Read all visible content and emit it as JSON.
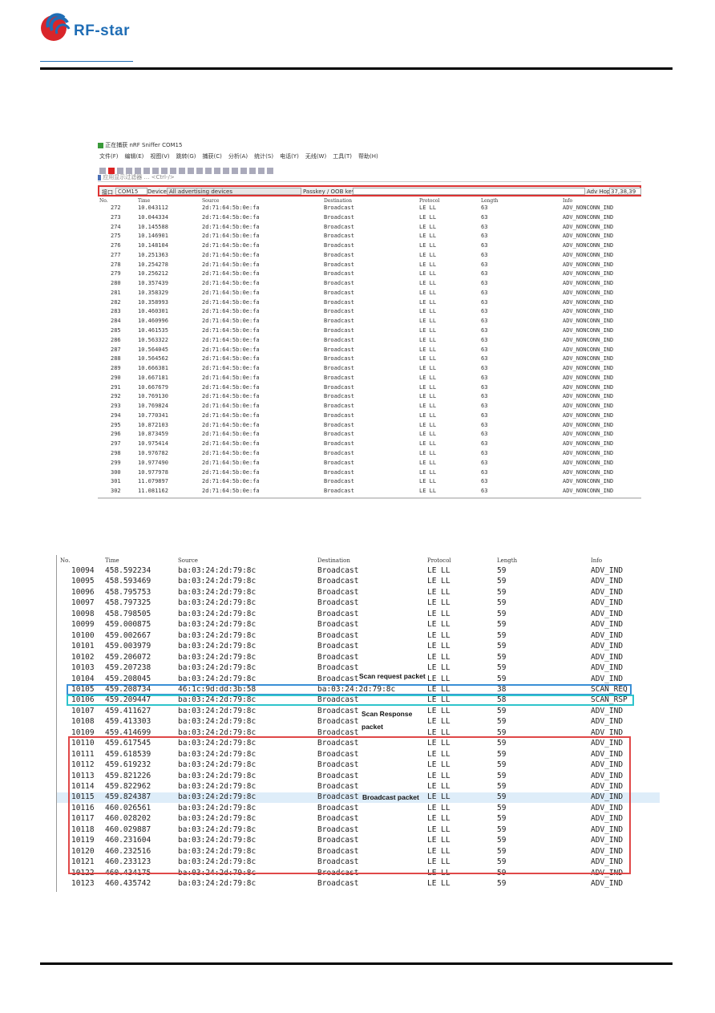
{
  "header": {
    "logo_text": "RF-star",
    "brand_color": "#1f6db5",
    "logo_icon": "rf-star-logo"
  },
  "screenshot1": {
    "title": "正在捕获 nRF Sniffer COM15",
    "menu": [
      "文件(F)",
      "编辑(E)",
      "视图(V)",
      "跳转(G)",
      "捕获(C)",
      "分析(A)",
      "统计(S)",
      "电话(Y)",
      "无线(W)",
      "工具(T)",
      "帮助(H)"
    ],
    "display_filter_placeholder": "应用显示过滤器 … <Ctrl-/>",
    "interface_label": "接口",
    "interface_value": "COM15",
    "device_label": "Device",
    "device_value": "All advertising devices",
    "passkey_label": "Passkey / OOB key",
    "passkey_value": "",
    "adv_hop_label": "Adv Hop",
    "adv_hop_value": "37,38,39",
    "columns": [
      "No.",
      "Time",
      "Source",
      "Destination",
      "Protocol",
      "Length",
      "Info"
    ],
    "rows": [
      [
        "272",
        "10.043112",
        "2d:71:64:5b:0e:fa",
        "Broadcast",
        "LE LL",
        "63",
        "ADV_NONCONN_IND"
      ],
      [
        "273",
        "10.044334",
        "2d:71:64:5b:0e:fa",
        "Broadcast",
        "LE LL",
        "63",
        "ADV_NONCONN_IND"
      ],
      [
        "274",
        "10.145588",
        "2d:71:64:5b:0e:fa",
        "Broadcast",
        "LE LL",
        "63",
        "ADV_NONCONN_IND"
      ],
      [
        "275",
        "10.146901",
        "2d:71:64:5b:0e:fa",
        "Broadcast",
        "LE LL",
        "63",
        "ADV_NONCONN_IND"
      ],
      [
        "276",
        "10.148104",
        "2d:71:64:5b:0e:fa",
        "Broadcast",
        "LE LL",
        "63",
        "ADV_NONCONN_IND"
      ],
      [
        "277",
        "10.251363",
        "2d:71:64:5b:0e:fa",
        "Broadcast",
        "LE LL",
        "63",
        "ADV_NONCONN_IND"
      ],
      [
        "278",
        "10.254278",
        "2d:71:64:5b:0e:fa",
        "Broadcast",
        "LE LL",
        "63",
        "ADV_NONCONN_IND"
      ],
      [
        "279",
        "10.256212",
        "2d:71:64:5b:0e:fa",
        "Broadcast",
        "LE LL",
        "63",
        "ADV_NONCONN_IND"
      ],
      [
        "280",
        "10.357439",
        "2d:71:64:5b:0e:fa",
        "Broadcast",
        "LE LL",
        "63",
        "ADV_NONCONN_IND"
      ],
      [
        "281",
        "10.358329",
        "2d:71:64:5b:0e:fa",
        "Broadcast",
        "LE LL",
        "63",
        "ADV_NONCONN_IND"
      ],
      [
        "282",
        "10.358993",
        "2d:71:64:5b:0e:fa",
        "Broadcast",
        "LE LL",
        "63",
        "ADV_NONCONN_IND"
      ],
      [
        "283",
        "10.460301",
        "2d:71:64:5b:0e:fa",
        "Broadcast",
        "LE LL",
        "63",
        "ADV_NONCONN_IND"
      ],
      [
        "284",
        "10.460996",
        "2d:71:64:5b:0e:fa",
        "Broadcast",
        "LE LL",
        "63",
        "ADV_NONCONN_IND"
      ],
      [
        "285",
        "10.461535",
        "2d:71:64:5b:0e:fa",
        "Broadcast",
        "LE LL",
        "63",
        "ADV_NONCONN_IND"
      ],
      [
        "286",
        "10.563322",
        "2d:71:64:5b:0e:fa",
        "Broadcast",
        "LE LL",
        "63",
        "ADV_NONCONN_IND"
      ],
      [
        "287",
        "10.564045",
        "2d:71:64:5b:0e:fa",
        "Broadcast",
        "LE LL",
        "63",
        "ADV_NONCONN_IND"
      ],
      [
        "288",
        "10.564562",
        "2d:71:64:5b:0e:fa",
        "Broadcast",
        "LE LL",
        "63",
        "ADV_NONCONN_IND"
      ],
      [
        "289",
        "10.666381",
        "2d:71:64:5b:0e:fa",
        "Broadcast",
        "LE LL",
        "63",
        "ADV_NONCONN_IND"
      ],
      [
        "290",
        "10.667181",
        "2d:71:64:5b:0e:fa",
        "Broadcast",
        "LE LL",
        "63",
        "ADV_NONCONN_IND"
      ],
      [
        "291",
        "10.667679",
        "2d:71:64:5b:0e:fa",
        "Broadcast",
        "LE LL",
        "63",
        "ADV_NONCONN_IND"
      ],
      [
        "292",
        "10.769130",
        "2d:71:64:5b:0e:fa",
        "Broadcast",
        "LE LL",
        "63",
        "ADV_NONCONN_IND"
      ],
      [
        "293",
        "10.769824",
        "2d:71:64:5b:0e:fa",
        "Broadcast",
        "LE LL",
        "63",
        "ADV_NONCONN_IND"
      ],
      [
        "294",
        "10.770341",
        "2d:71:64:5b:0e:fa",
        "Broadcast",
        "LE LL",
        "63",
        "ADV_NONCONN_IND"
      ],
      [
        "295",
        "10.872103",
        "2d:71:64:5b:0e:fa",
        "Broadcast",
        "LE LL",
        "63",
        "ADV_NONCONN_IND"
      ],
      [
        "296",
        "10.873459",
        "2d:71:64:5b:0e:fa",
        "Broadcast",
        "LE LL",
        "63",
        "ADV_NONCONN_IND"
      ],
      [
        "297",
        "10.975414",
        "2d:71:64:5b:0e:fa",
        "Broadcast",
        "LE LL",
        "63",
        "ADV_NONCONN_IND"
      ],
      [
        "298",
        "10.976782",
        "2d:71:64:5b:0e:fa",
        "Broadcast",
        "LE LL",
        "63",
        "ADV_NONCONN_IND"
      ],
      [
        "299",
        "10.977490",
        "2d:71:64:5b:0e:fa",
        "Broadcast",
        "LE LL",
        "63",
        "ADV_NONCONN_IND"
      ],
      [
        "300",
        "10.977978",
        "2d:71:64:5b:0e:fa",
        "Broadcast",
        "LE LL",
        "63",
        "ADV_NONCONN_IND"
      ],
      [
        "301",
        "11.079897",
        "2d:71:64:5b:0e:fa",
        "Broadcast",
        "LE LL",
        "63",
        "ADV_NONCONN_IND"
      ],
      [
        "302",
        "11.081162",
        "2d:71:64:5b:0e:fa",
        "Broadcast",
        "LE LL",
        "63",
        "ADV_NONCONN_IND"
      ]
    ]
  },
  "screenshot2": {
    "columns": [
      "No.",
      "Time",
      "Source",
      "Destination",
      "Protocol",
      "Length",
      "Info"
    ],
    "rows": [
      [
        "10094",
        "458.592234",
        "ba:03:24:2d:79:8c",
        "Broadcast",
        "LE LL",
        "59",
        "ADV_IND"
      ],
      [
        "10095",
        "458.593469",
        "ba:03:24:2d:79:8c",
        "Broadcast",
        "LE LL",
        "59",
        "ADV_IND"
      ],
      [
        "10096",
        "458.795753",
        "ba:03:24:2d:79:8c",
        "Broadcast",
        "LE LL",
        "59",
        "ADV_IND"
      ],
      [
        "10097",
        "458.797325",
        "ba:03:24:2d:79:8c",
        "Broadcast",
        "LE LL",
        "59",
        "ADV_IND"
      ],
      [
        "10098",
        "458.798505",
        "ba:03:24:2d:79:8c",
        "Broadcast",
        "LE LL",
        "59",
        "ADV_IND"
      ],
      [
        "10099",
        "459.000875",
        "ba:03:24:2d:79:8c",
        "Broadcast",
        "LE LL",
        "59",
        "ADV_IND"
      ],
      [
        "10100",
        "459.002667",
        "ba:03:24:2d:79:8c",
        "Broadcast",
        "LE LL",
        "59",
        "ADV_IND"
      ],
      [
        "10101",
        "459.003979",
        "ba:03:24:2d:79:8c",
        "Broadcast",
        "LE LL",
        "59",
        "ADV_IND"
      ],
      [
        "10102",
        "459.206072",
        "ba:03:24:2d:79:8c",
        "Broadcast",
        "LE LL",
        "59",
        "ADV_IND"
      ],
      [
        "10103",
        "459.207238",
        "ba:03:24:2d:79:8c",
        "Broadcast",
        "LE LL",
        "59",
        "ADV_IND"
      ],
      [
        "10104",
        "459.208045",
        "ba:03:24:2d:79:8c",
        "Broadcast",
        "LE LL",
        "59",
        "ADV_IND"
      ],
      [
        "10105",
        "459.208734",
        "46:1c:9d:dd:3b:58",
        "ba:03:24:2d:79:8c",
        "LE LL",
        "38",
        "SCAN_REQ"
      ],
      [
        "10106",
        "459.209447",
        "ba:03:24:2d:79:8c",
        "Broadcast",
        "LE LL",
        "58",
        "SCAN_RSP"
      ],
      [
        "10107",
        "459.411627",
        "ba:03:24:2d:79:8c",
        "Broadcast",
        "LE LL",
        "59",
        "ADV_IND"
      ],
      [
        "10108",
        "459.413303",
        "ba:03:24:2d:79:8c",
        "Broadcast",
        "LE LL",
        "59",
        "ADV_IND"
      ],
      [
        "10109",
        "459.414699",
        "ba:03:24:2d:79:8c",
        "Broadcast",
        "LE LL",
        "59",
        "ADV_IND"
      ],
      [
        "10110",
        "459.617545",
        "ba:03:24:2d:79:8c",
        "Broadcast",
        "LE LL",
        "59",
        "ADV_IND"
      ],
      [
        "10111",
        "459.618539",
        "ba:03:24:2d:79:8c",
        "Broadcast",
        "LE LL",
        "59",
        "ADV_IND"
      ],
      [
        "10112",
        "459.619232",
        "ba:03:24:2d:79:8c",
        "Broadcast",
        "LE LL",
        "59",
        "ADV_IND"
      ],
      [
        "10113",
        "459.821226",
        "ba:03:24:2d:79:8c",
        "Broadcast",
        "LE LL",
        "59",
        "ADV_IND"
      ],
      [
        "10114",
        "459.822962",
        "ba:03:24:2d:79:8c",
        "Broadcast",
        "LE LL",
        "59",
        "ADV_IND"
      ],
      [
        "10115",
        "459.824387",
        "ba:03:24:2d:79:8c",
        "Broadcast",
        "LE LL",
        "59",
        "ADV_IND"
      ],
      [
        "10116",
        "460.026561",
        "ba:03:24:2d:79:8c",
        "Broadcast",
        "LE LL",
        "59",
        "ADV_IND"
      ],
      [
        "10117",
        "460.028202",
        "ba:03:24:2d:79:8c",
        "Broadcast",
        "LE LL",
        "59",
        "ADV_IND"
      ],
      [
        "10118",
        "460.029887",
        "ba:03:24:2d:79:8c",
        "Broadcast",
        "LE LL",
        "59",
        "ADV_IND"
      ],
      [
        "10119",
        "460.231604",
        "ba:03:24:2d:79:8c",
        "Broadcast",
        "LE LL",
        "59",
        "ADV_IND"
      ],
      [
        "10120",
        "460.232516",
        "ba:03:24:2d:79:8c",
        "Broadcast",
        "LE LL",
        "59",
        "ADV_IND"
      ],
      [
        "10121",
        "460.233123",
        "ba:03:24:2d:79:8c",
        "Broadcast",
        "LE LL",
        "59",
        "ADV_IND"
      ],
      [
        "10122",
        "460.434175",
        "ba:03:24:2d:79:8c",
        "Broadcast",
        "LE LL",
        "59",
        "ADV_IND"
      ],
      [
        "10123",
        "460.435742",
        "ba:03:24:2d:79:8c",
        "Broadcast",
        "LE LL",
        "59",
        "ADV_IND"
      ]
    ],
    "annotations": {
      "scan_request": "Scan request packet",
      "scan_response_1": "Scan Response",
      "scan_response_2": "packet",
      "broadcast": "Broadcast packet"
    },
    "colors": {
      "scan_req_box": "#3a8fd6",
      "scan_rsp_box": "#2fc4cc",
      "broadcast_box": "#e04848",
      "selected_row": "#deedf9"
    }
  }
}
